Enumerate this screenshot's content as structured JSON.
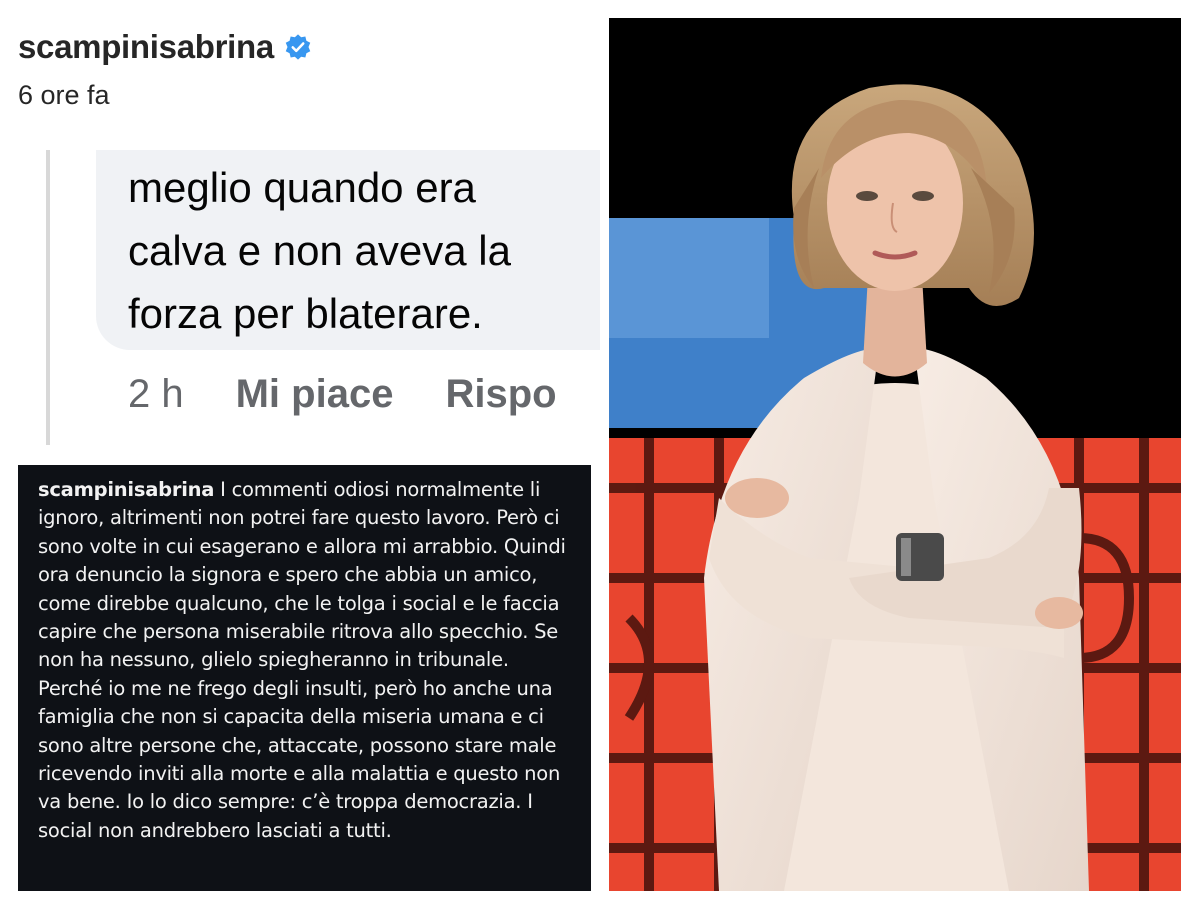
{
  "post_header": {
    "username": "scampinisabrina",
    "time_ago": "6 ore fa"
  },
  "comment": {
    "line1": "meglio quando era",
    "line2": "calva e non aveva la",
    "line3": "forza per blaterare.",
    "time": "2 h",
    "like_label": "Mi piace",
    "reply_label": "Rispo"
  },
  "caption": {
    "username": "scampinisabrina",
    "text": "I commenti odiosi normalmente li ignoro, altrimenti non potrei fare questo lavoro. Però ci sono volte in cui esagerano e allora mi arrabbio. Quindi ora denuncio la signora e spero che abbia un amico, come direbbe qualcuno, che le tolga i social e le faccia capire che persona miserabile ritrova allo specchio. Se non ha nessuno, glielo spiegheranno in tribunale. Perché io me ne frego degli insulti, però ho anche una famiglia che non si capacita della miseria umana e ci sono altre persone che, attaccate, possono stare male ricevendo inviti alla morte e alla malattia e questo non va bene. Io lo dico sempre: c’è troppa democrazia. I social non andrebbero lasciati a tutti."
  },
  "icons": {
    "verified": "verified-badge-icon"
  },
  "colors": {
    "verified_blue": "#3897f0",
    "caption_bg": "#0e1116",
    "stage_red": "#e8452f",
    "stage_blue": "#3f80c9"
  }
}
